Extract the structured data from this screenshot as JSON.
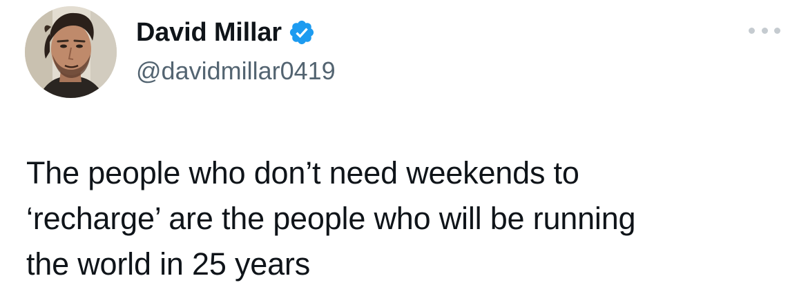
{
  "author": {
    "display_name": "David Millar",
    "handle": "@davidmillar0419",
    "verified_icon": "verified-badge-icon",
    "avatar": "profile-photo",
    "verified_color": "#1d9bf0"
  },
  "tweet": {
    "text": "The people who don’t need weekends to\n‘recharge’ are the people who will be running\nthe world in 25 years"
  },
  "actions": {
    "more_icon": "more-options-icon"
  },
  "colors": {
    "text": "#0f1419",
    "secondary_text": "#536471",
    "background": "#ffffff"
  }
}
